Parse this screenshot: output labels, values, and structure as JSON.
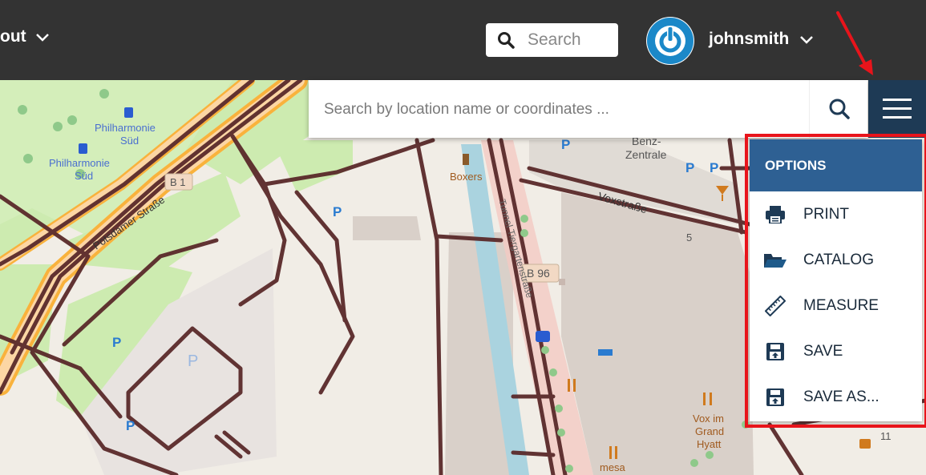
{
  "topbar": {
    "about_label": "out",
    "search_placeholder": "Search",
    "username": "johnsmith"
  },
  "location_search": {
    "placeholder": "Search by location name or coordinates ..."
  },
  "options_menu": {
    "header": "OPTIONS",
    "items": [
      {
        "label": "PRINT",
        "icon": "print-icon"
      },
      {
        "label": "CATALOG",
        "icon": "folder-open-icon"
      },
      {
        "label": "MEASURE",
        "icon": "ruler-icon"
      },
      {
        "label": "SAVE",
        "icon": "save-icon"
      },
      {
        "label": "SAVE AS...",
        "icon": "save-as-icon"
      }
    ]
  },
  "map_labels": {
    "philharmonie1": "Philharmonie",
    "sud1": "Süd",
    "philharmonie2": "Philharmonie",
    "sud2": "Süd",
    "b1": "B 1",
    "potsdamer": "Potsdamer Straße",
    "boxers": "Boxers",
    "benz": "Benz-",
    "zentrale": "Zentrale",
    "voxstrasse": "Voxstraße",
    "num5": "5",
    "b96": "B 96",
    "tunnel": "Tunnel Tiergartenstraße",
    "voxim": "Vox im",
    "grand": "Grand",
    "hyatt": "Hyatt",
    "mesa": "mesa",
    "num11": "11",
    "parking_p": "P"
  },
  "colors": {
    "topbar": "#333333",
    "menu_button": "#1e3a55",
    "options_header": "#2e6093",
    "highlight": "#e8141b",
    "avatar": "#1b88c8"
  }
}
